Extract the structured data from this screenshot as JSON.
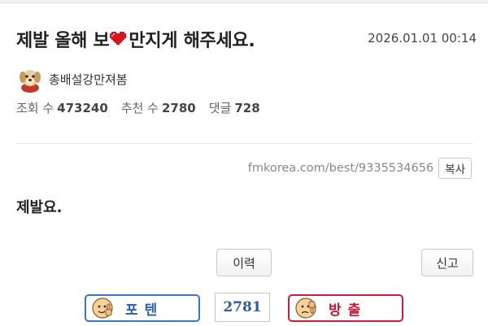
{
  "post": {
    "title_before": "제발 올해 보",
    "title_after": "만지게 해주세요.",
    "title_inline_icon": "pixel-heart-icon",
    "datetime": "2026.01.01 00:14",
    "author": {
      "name": "총배설강만져봄",
      "avatar_icon": "puppy-avatar-icon"
    },
    "stats": {
      "views_label": "조회 수",
      "views": "473240",
      "recommend_label": "추천 수",
      "recommend": "2780",
      "comments_label": "댓글",
      "comments": "728"
    },
    "url": "fmkorea.com/best/9335534656",
    "copy_label": "복사",
    "body": "제발요."
  },
  "actions": {
    "history_label": "이력",
    "report_label": "신고"
  },
  "votes": {
    "up_label": "포텐",
    "up_icon": "thumbs-up-face-icon",
    "count": "2781",
    "down_label": "방출",
    "down_icon": "thumbs-down-face-icon"
  },
  "colors": {
    "up_border": "#3a74c7",
    "down_border": "#c51f3a",
    "heart": "#d9141f"
  }
}
